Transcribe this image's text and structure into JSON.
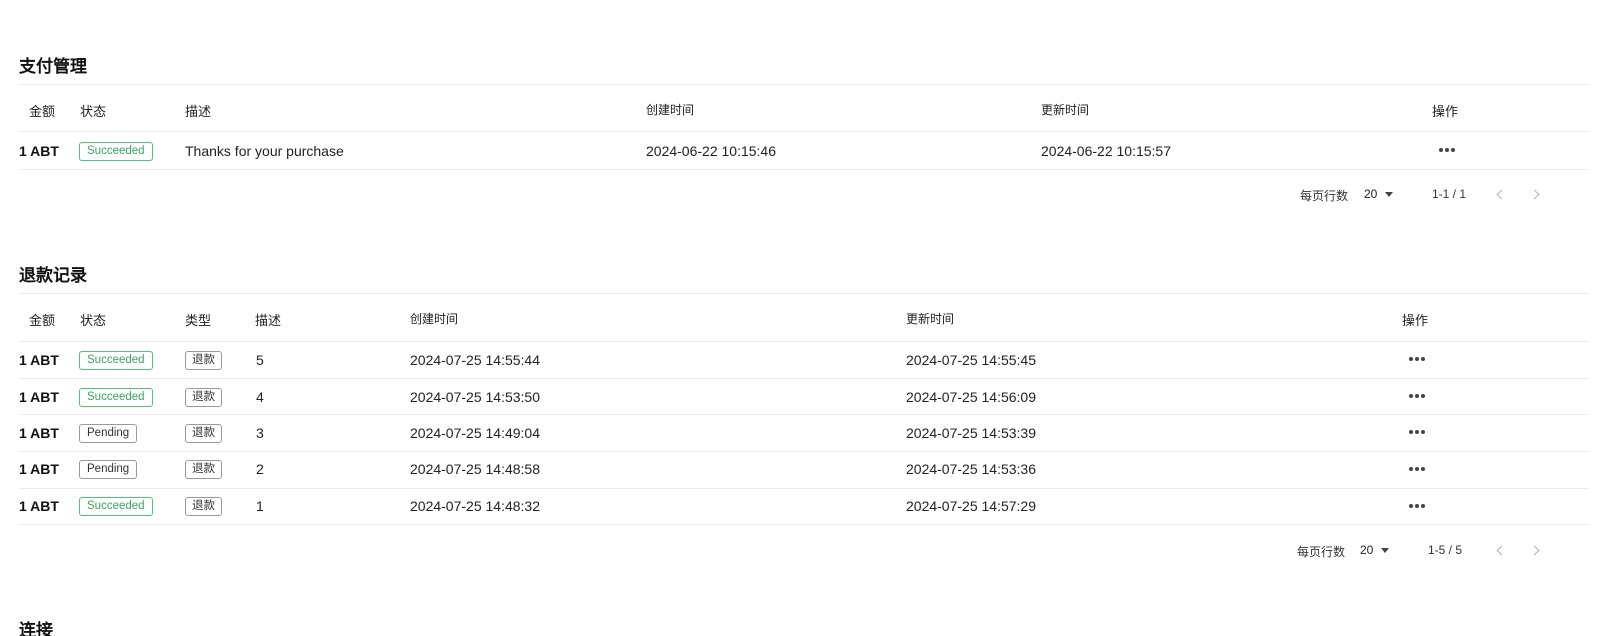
{
  "payments": {
    "title": "支付管理",
    "columns": [
      "金额",
      "状态",
      "描述",
      "创建时间",
      "更新时间",
      "操作"
    ],
    "rows": [
      {
        "amount": "1 ABT",
        "status": "Succeeded",
        "description": "Thanks for your purchase",
        "created": "2024-06-22 10:15:46",
        "updated": "2024-06-22 10:15:57"
      }
    ],
    "pagination": {
      "rows_per_page_label": "每页行数",
      "rows_per_page": "20",
      "range": "1-1 / 1"
    }
  },
  "refunds": {
    "title": "退款记录",
    "columns": [
      "金额",
      "状态",
      "类型",
      "描述",
      "创建时间",
      "更新时间",
      "操作"
    ],
    "rows": [
      {
        "amount": "1 ABT",
        "status": "Succeeded",
        "type": "退款",
        "description": "5",
        "created": "2024-07-25 14:55:44",
        "updated": "2024-07-25 14:55:45"
      },
      {
        "amount": "1 ABT",
        "status": "Succeeded",
        "type": "退款",
        "description": "4",
        "created": "2024-07-25 14:53:50",
        "updated": "2024-07-25 14:56:09"
      },
      {
        "amount": "1 ABT",
        "status": "Pending",
        "type": "退款",
        "description": "3",
        "created": "2024-07-25 14:49:04",
        "updated": "2024-07-25 14:53:39"
      },
      {
        "amount": "1 ABT",
        "status": "Pending",
        "type": "退款",
        "description": "2",
        "created": "2024-07-25 14:48:58",
        "updated": "2024-07-25 14:53:36"
      },
      {
        "amount": "1 ABT",
        "status": "Succeeded",
        "type": "退款",
        "description": "1",
        "created": "2024-07-25 14:48:32",
        "updated": "2024-07-25 14:57:29"
      }
    ],
    "pagination": {
      "rows_per_page_label": "每页行数",
      "rows_per_page": "20",
      "range": "1-5 / 5"
    }
  },
  "next_section": {
    "title": "连接"
  },
  "colors": {
    "success": "#3aa55e",
    "neutral": "#333333",
    "divider": "#ececec"
  },
  "icons": {
    "row_actions": "more-horizontal-icon",
    "dropdown": "caret-down-icon",
    "prev": "chevron-left-icon",
    "next": "chevron-right-icon"
  }
}
